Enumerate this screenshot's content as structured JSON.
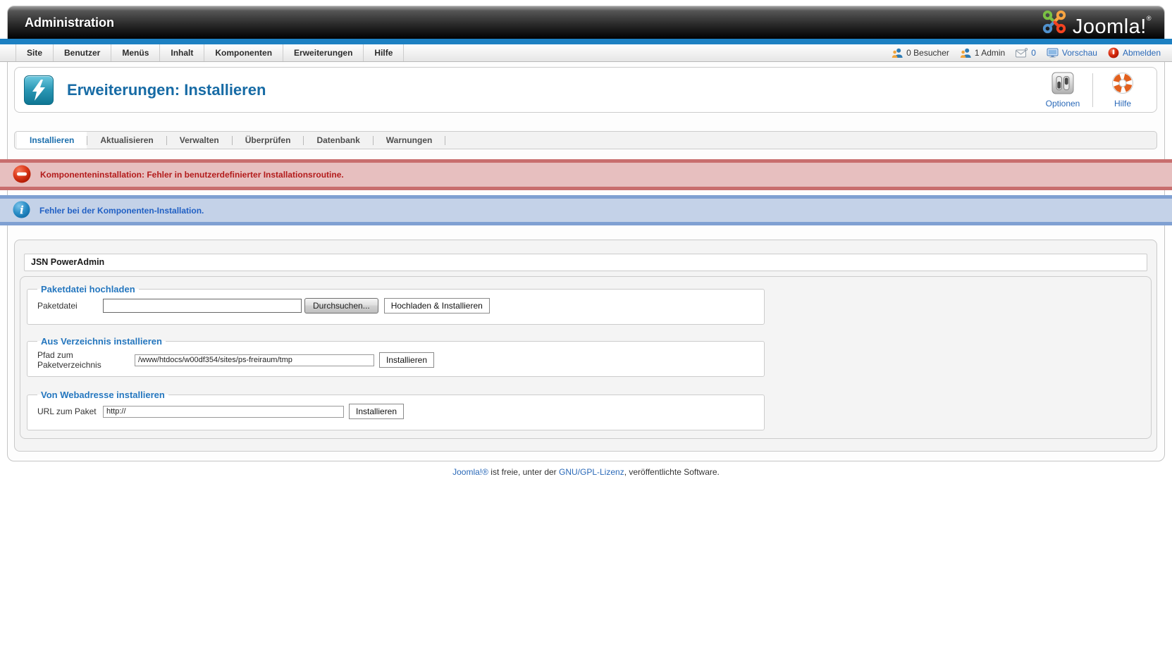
{
  "brand": {
    "app_title": "Administration",
    "logo_text": "Joomla!",
    "logo_mark": "®"
  },
  "menubar": {
    "items": [
      "Site",
      "Benutzer",
      "Menüs",
      "Inhalt",
      "Komponenten",
      "Erweiterungen",
      "Hilfe"
    ],
    "status": {
      "visitors": "0 Besucher",
      "admins": "1 Admin",
      "messages_count": "0",
      "preview": "Vorschau",
      "logout": "Abmelden"
    }
  },
  "page": {
    "title": "Erweiterungen: Installieren",
    "toolbar": {
      "options_label": "Optionen",
      "help_label": "Hilfe"
    }
  },
  "submenu": {
    "items": [
      "Installieren",
      "Aktualisieren",
      "Verwalten",
      "Überprüfen",
      "Datenbank",
      "Warnungen"
    ],
    "active": "Installieren"
  },
  "messages": {
    "error_text": "Komponenteninstallation: Fehler in benutzerdefinierter Installationsroutine.",
    "info_text": "Fehler bei der Komponenten-Installation."
  },
  "content": {
    "extension_name": "JSN PowerAdmin",
    "upload_package": {
      "legend": "Paketdatei hochladen",
      "field_label": "Paketdatei",
      "file_value": "",
      "browse_label": "Durchsuchen...",
      "submit_label": "Hochladen & Installieren"
    },
    "install_from_directory": {
      "legend": "Aus Verzeichnis installieren",
      "field_label": "Pfad zum Paketverzeichnis",
      "field_value": "/www/htdocs/w00df354/sites/ps-freiraum/tmp",
      "submit_label": "Installieren"
    },
    "install_from_url": {
      "legend": "Von Webadresse installieren",
      "field_label": "URL zum Paket",
      "field_value": "http://",
      "submit_label": "Installieren"
    }
  },
  "footer": {
    "link_joomla": "Joomla!®",
    "text_mid": " ist freie, unter der ",
    "link_license": "GNU/GPL-Lizenz",
    "text_end": ", veröffentlichte Software."
  },
  "colors": {
    "joomla_blue": "#1c80c2",
    "title_blue": "#176ba5",
    "legend_blue": "#2476be",
    "link_blue": "#2a69b8",
    "error_bg": "#e7bfbf",
    "error_border": "#c86e6e",
    "error_text": "#b31b1b",
    "info_bg": "#c4d2e8",
    "info_border": "#7fa0d2",
    "info_text": "#2160c4",
    "logo_green": "#7ac143",
    "logo_yellow": "#f9a541",
    "logo_red": "#f44321",
    "logo_blue_node": "#5091cd"
  }
}
